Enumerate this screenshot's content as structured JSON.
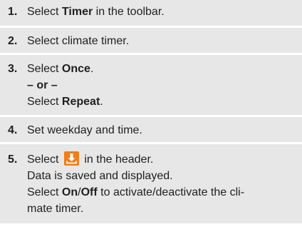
{
  "steps": [
    {
      "number": "1.",
      "prefix": "Select ",
      "bold": "Timer",
      "suffix": " in the toolbar."
    },
    {
      "number": "2.",
      "text": "Select climate timer."
    },
    {
      "number": "3.",
      "line1_prefix": "Select ",
      "line1_bold": "Once",
      "line1_suffix": ".",
      "or": "– or –",
      "line3_prefix": "Select ",
      "line3_bold": "Repeat",
      "line3_suffix": "."
    },
    {
      "number": "4.",
      "text": "Set weekday and time."
    },
    {
      "number": "5.",
      "line1_prefix": "Select ",
      "icon": "save-icon",
      "line1_suffix": " in the header.",
      "line2": "Data is saved and displayed.",
      "line3_prefix": "Select ",
      "line3_bold_on": "On",
      "line3_slash": "/",
      "line3_bold_off": "Off",
      "line3_suffix": " to activate/deactivate the cli-",
      "line4": "mate timer."
    }
  ],
  "colors": {
    "step_background": "#e7e7e7",
    "icon_background": "#f07d18",
    "icon_foreground": "#ffffff"
  }
}
